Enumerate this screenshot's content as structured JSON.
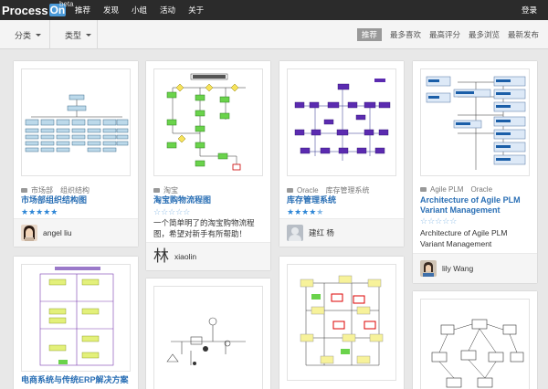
{
  "app": {
    "logo_word": "Process",
    "logo_on": "On",
    "logo_beta": "beta",
    "nav": [
      "推荐",
      "发现",
      "小组",
      "活动",
      "关于"
    ],
    "login": "登录"
  },
  "filters": {
    "category_label": "分类",
    "type_label": "类型",
    "sorts": [
      "推荐",
      "最多喜欢",
      "最高评分",
      "最多浏览",
      "最新发布"
    ],
    "active_sort": "推荐"
  },
  "cards": [
    {
      "tags": [
        "市场部",
        "组织结构"
      ],
      "title": "市场部组织结构图",
      "rating": 5,
      "author": "angel liu"
    },
    {
      "tags": [
        "淘宝"
      ],
      "title": "淘宝购物流程图",
      "rating": 0,
      "description": [
        "一个简单明了的淘宝购物流程",
        "图，希望对新手有所帮助！"
      ],
      "author_char": "林",
      "author": "xiaolin"
    },
    {
      "tags": [
        "Oracle",
        "库存管理系统"
      ],
      "title": "库存管理系统",
      "rating": 4.5,
      "author": "建红 杨"
    },
    {
      "tags": [
        "Agile PLM",
        "Oracle"
      ],
      "title": [
        "Architecture of Agile PLM",
        "Variant Management"
      ],
      "rating": 0,
      "description": [
        "Architecture of Agile PLM",
        "Variant Management"
      ],
      "author": "lily Wang"
    },
    {
      "title": "电商系统与传统ERP解决方案"
    }
  ]
}
